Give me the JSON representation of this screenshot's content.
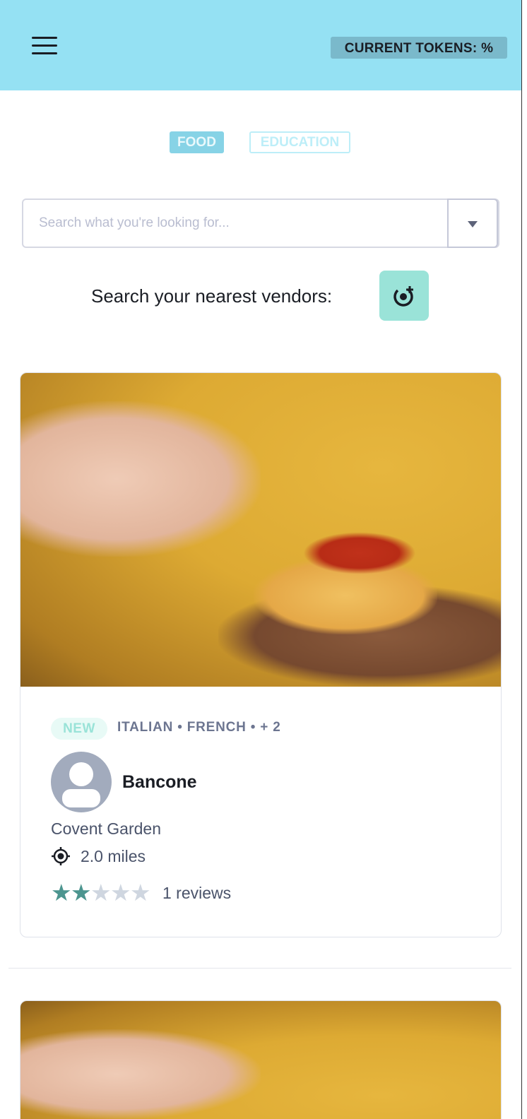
{
  "header": {
    "tokens_label": "CURRENT TOKENS: %",
    "bg_color": "#95e1f3"
  },
  "tabs": [
    {
      "label": "FOOD",
      "active": true
    },
    {
      "label": "EDUCATION",
      "active": false
    }
  ],
  "search": {
    "placeholder": "Search what you're looking for...",
    "value": ""
  },
  "nearest": {
    "label": "Search your nearest vendors:"
  },
  "vendors": [
    {
      "badge": "NEW",
      "categories": "ITALIAN • FRENCH • + 2",
      "name": "Bancone",
      "area": "Covent Garden",
      "distance": "2.0 miles",
      "rating": 2,
      "max_rating": 5,
      "reviews": "1 reviews"
    }
  ]
}
